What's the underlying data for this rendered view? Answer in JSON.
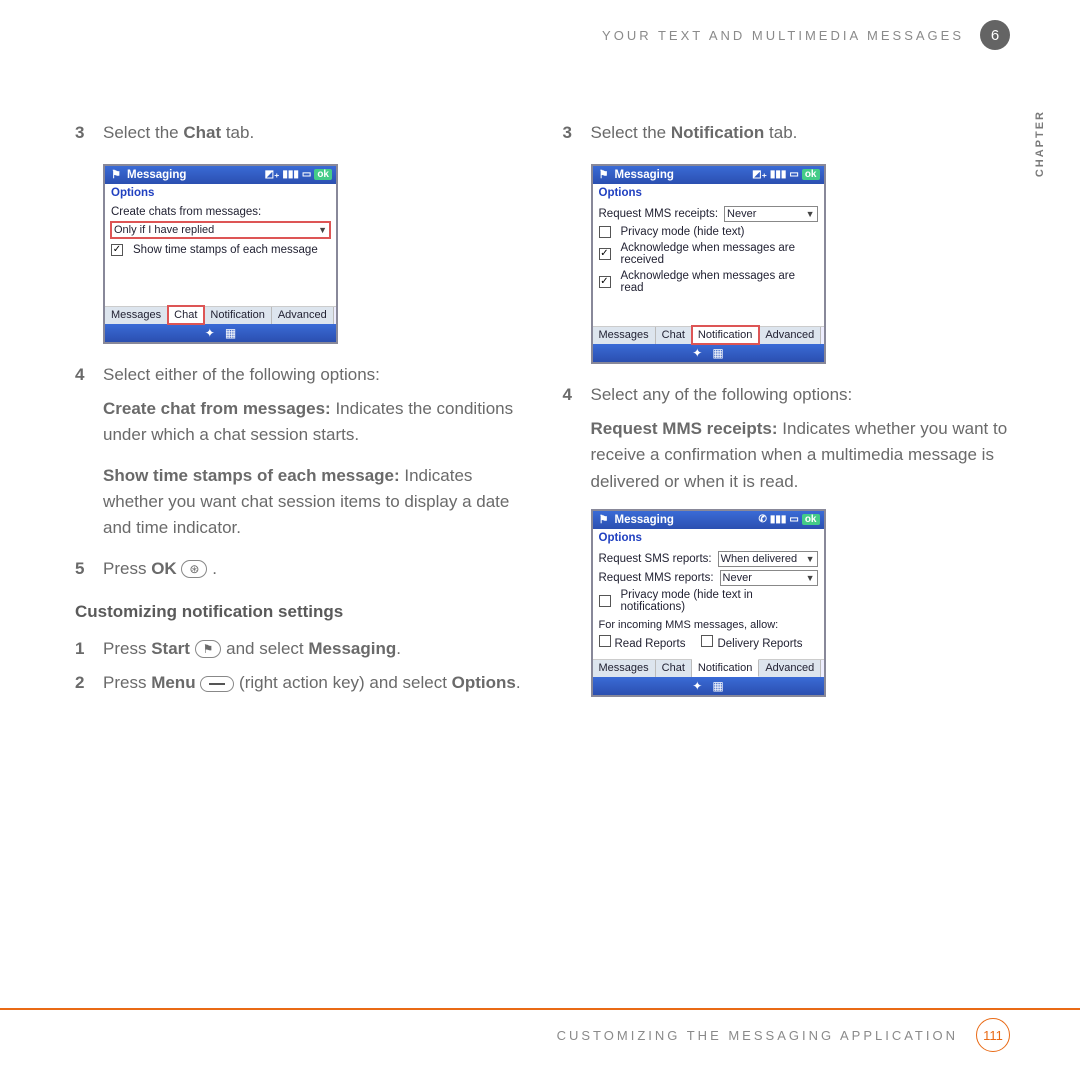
{
  "header": {
    "section": "YOUR TEXT AND MULTIMEDIA MESSAGES",
    "chapter_num": "6",
    "chapter_label": "CHAPTER"
  },
  "footer": {
    "text": "CUSTOMIZING THE MESSAGING APPLICATION",
    "page": "111"
  },
  "left": {
    "step3_num": "3",
    "step3_pre": "Select the ",
    "step3_b": "Chat",
    "step3_post": " tab.",
    "step4_num": "4",
    "step4_text": "Select either of the following options:",
    "opt1_b": "Create chat from messages:",
    "opt1_t": " Indicates the conditions under which a chat session starts.",
    "opt2_b": "Show time stamps of each message:",
    "opt2_t": " Indicates whether you want chat session items to display a date and time indicator.",
    "step5_num": "5",
    "step5_pre": "Press ",
    "step5_b": "OK",
    "step5_icon": "⊛",
    "step5_post": " .",
    "subhead": "Customizing notification settings",
    "s1_num": "1",
    "s1_pre": "Press ",
    "s1_b1": "Start",
    "s1_icon": "⚑",
    "s1_mid": " and select ",
    "s1_b2": "Messaging",
    "s1_end": ".",
    "s2_num": "2",
    "s2_pre": "Press ",
    "s2_b1": "Menu",
    "s2_paren": " (right action key) and select ",
    "s2_b2": "Options",
    "s2_end": "."
  },
  "right": {
    "step3_num": "3",
    "step3_pre": "Select the ",
    "step3_b": "Notification",
    "step3_post": " tab.",
    "step4_num": "4",
    "step4_text": "Select any of the following options:",
    "opt1_b": "Request MMS receipts:",
    "opt1_t": " Indicates whether you want to receive a confirmation when a multimedia message is delivered or when it is read."
  },
  "mini_common": {
    "title": "Messaging",
    "subtitle": "Options",
    "ok": "ok",
    "tab_messages": "Messages",
    "tab_chat": "Chat",
    "tab_notification": "Notification",
    "tab_advanced": "Advanced",
    "soft1": "✦",
    "soft2": "▦"
  },
  "mini_chat": {
    "lbl_create": "Create chats from messages:",
    "sel_create": "Only if I have replied",
    "cb_show": "Show time stamps of each message"
  },
  "mini_notif1": {
    "lbl_req": "Request MMS receipts:",
    "sel_req": "Never",
    "cb_priv": "Privacy mode (hide text)",
    "cb_ack_recv": "Acknowledge when messages are received",
    "cb_ack_read": "Acknowledge when messages are read"
  },
  "mini_notif2": {
    "lbl_sms": "Request SMS reports:",
    "sel_sms": "When delivered",
    "lbl_mms": "Request MMS reports:",
    "sel_mms": "Never",
    "cb_priv": "Privacy mode (hide text in notifications)",
    "sec_label": "For incoming MMS messages, allow:",
    "cb_read": "Read Reports",
    "cb_deliv": "Delivery Reports"
  }
}
